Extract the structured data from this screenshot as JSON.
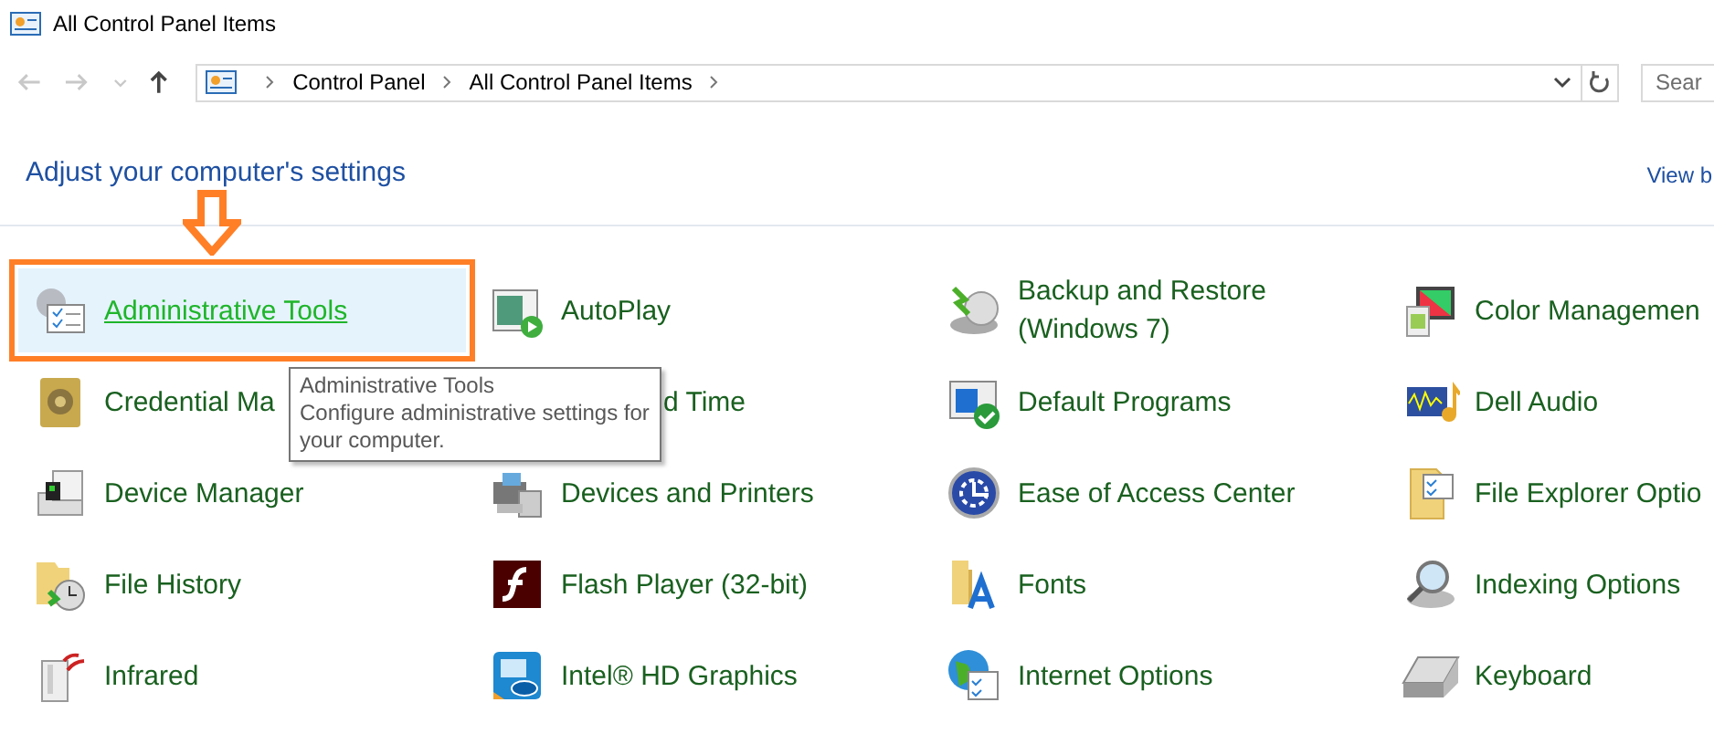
{
  "window": {
    "title": "All Control Panel Items"
  },
  "nav_buttons": [
    {
      "kind": "back",
      "disabled": true
    },
    {
      "kind": "forward",
      "disabled": true
    },
    {
      "kind": "recent",
      "disabled": true
    },
    {
      "kind": "up",
      "disabled": false
    }
  ],
  "address_bar": {
    "breadcrumbs": [
      "Control Panel",
      "All Control Panel Items"
    ]
  },
  "search": {
    "placeholder": "Sear"
  },
  "heading": "Adjust your computer's settings",
  "view_by": "View b",
  "items": [
    {
      "kind": "item",
      "label": "Administrative Tools",
      "selected": true
    },
    {
      "kind": "item",
      "label": "AutoPlay",
      "selected": false
    },
    {
      "kind": "item",
      "label": "Backup and Restore (Windows 7)",
      "selected": false
    },
    {
      "kind": "item",
      "label": "Color Managemen",
      "selected": false
    },
    {
      "kind": "item",
      "label": "Credential Ma",
      "selected": false
    },
    {
      "kind": "covered",
      "label": "d Time",
      "selected": false
    },
    {
      "kind": "item",
      "label": "Default Programs",
      "selected": false
    },
    {
      "kind": "item",
      "label": "Dell Audio",
      "selected": false
    },
    {
      "kind": "item",
      "label": "Device Manager",
      "selected": false
    },
    {
      "kind": "item",
      "label": "Devices and Printers",
      "selected": false
    },
    {
      "kind": "item",
      "label": "Ease of Access Center",
      "selected": false
    },
    {
      "kind": "item",
      "label": "File Explorer Optio",
      "selected": false
    },
    {
      "kind": "item",
      "label": "File History",
      "selected": false
    },
    {
      "kind": "item",
      "label": "Flash Player (32-bit)",
      "selected": false
    },
    {
      "kind": "item",
      "label": "Fonts",
      "selected": false
    },
    {
      "kind": "item",
      "label": "Indexing Options",
      "selected": false
    },
    {
      "kind": "item",
      "label": "Infrared",
      "selected": false
    },
    {
      "kind": "item",
      "label": "Intel® HD Graphics",
      "selected": false
    },
    {
      "kind": "item",
      "label": "Internet Options",
      "selected": false
    },
    {
      "kind": "item",
      "label": "Keyboard",
      "selected": false
    }
  ],
  "tooltip": {
    "title": "Administrative Tools",
    "description": "Configure administrative settings for your computer."
  }
}
